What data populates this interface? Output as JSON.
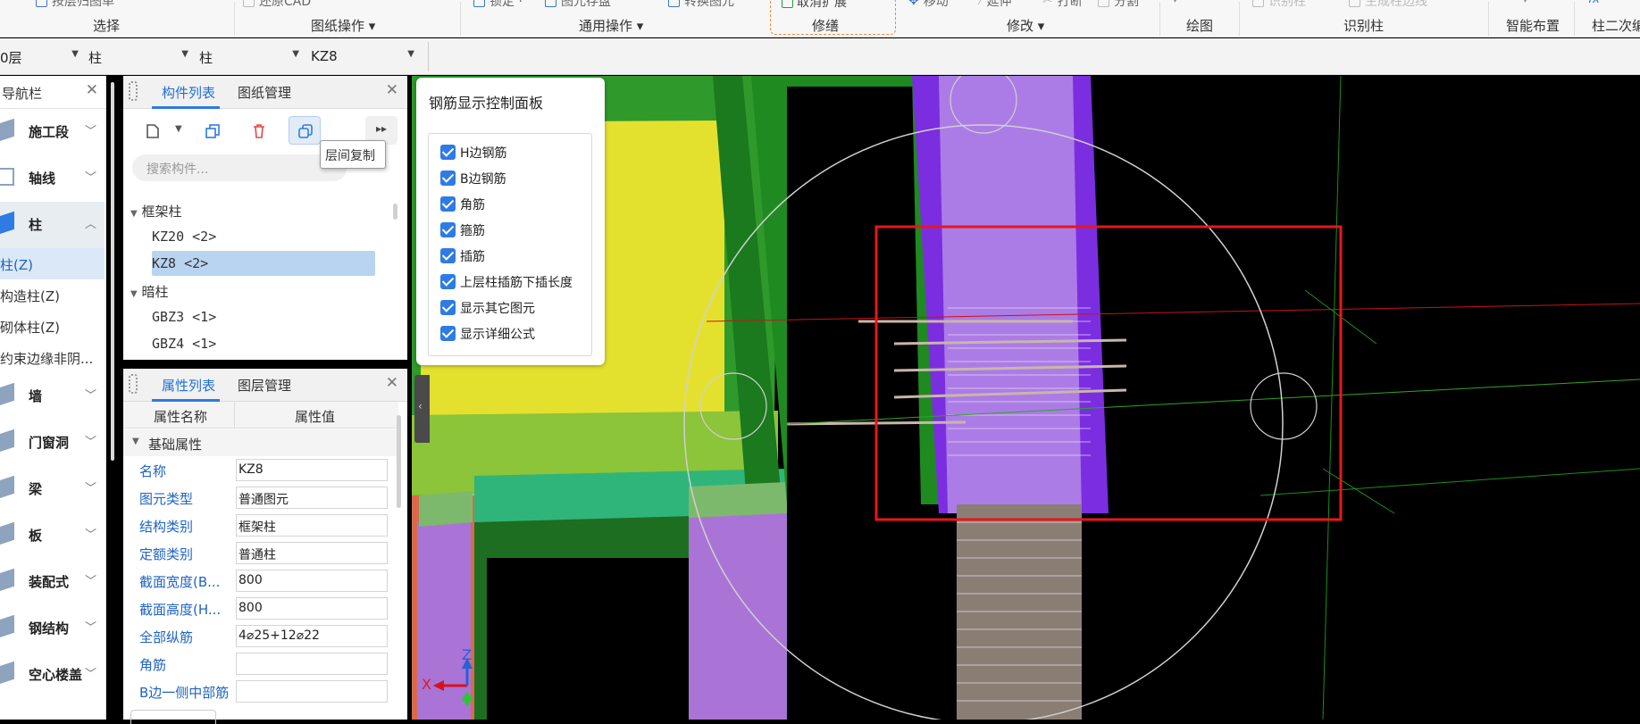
{
  "ribbon": {
    "groups": [
      {
        "cut": "按层归图单",
        "label": "选择"
      },
      {
        "cut": "还原CAD",
        "label": "图纸操作 ▾"
      },
      {
        "cut": "锁定 ·",
        "label": "通用操作 ▾"
      },
      {
        "cut": "图元存盘",
        "label": ""
      },
      {
        "cut": "转换图元",
        "label": ""
      },
      {
        "cut": "取消扩展",
        "label": "修缮"
      },
      {
        "cut": "移动",
        "label": "修改 ▾"
      },
      {
        "cut": "延伸",
        "label": ""
      },
      {
        "cut": "打断",
        "label": ""
      },
      {
        "cut": "分割",
        "label": ""
      },
      {
        "cut": "",
        "label": "绘图"
      },
      {
        "cut": "识别柱",
        "label": "识别柱"
      },
      {
        "cut": "生成柱边线",
        "label": ""
      },
      {
        "cut": "",
        "label": "智能布置"
      },
      {
        "cut": "fx",
        "label": "柱二次编"
      }
    ]
  },
  "filters": {
    "floor": "0层",
    "type1": "柱",
    "type2": "柱",
    "member": "KZ8"
  },
  "nav": {
    "title": "导航栏",
    "items": [
      {
        "label": "施工段"
      },
      {
        "label": "轴线"
      },
      {
        "label": "柱"
      },
      {
        "label": "墙"
      },
      {
        "label": "门窗洞"
      },
      {
        "label": "梁"
      },
      {
        "label": "板"
      },
      {
        "label": "装配式"
      },
      {
        "label": "钢结构"
      },
      {
        "label": "空心楼盖"
      }
    ],
    "sub_items": [
      "柱(Z)",
      "构造柱(Z)",
      "砌体柱(Z)",
      "约束边缘非阴..."
    ]
  },
  "component_panel": {
    "tabs": [
      "构件列表",
      "图纸管理"
    ],
    "search_placeholder": "搜索构件...",
    "tooltip": "层间复制",
    "categories": [
      {
        "name": "框架柱",
        "items": [
          "KZ20 <2>",
          "KZ8 <2>"
        ]
      },
      {
        "name": "暗柱",
        "items": [
          "GBZ3 <1>",
          "GBZ4 <1>"
        ]
      }
    ]
  },
  "property_panel": {
    "tabs": [
      "属性列表",
      "图层管理"
    ],
    "columns": [
      "属性名称",
      "属性值"
    ],
    "group": "基础属性",
    "rows": [
      {
        "name": "名称",
        "value": "KZ8"
      },
      {
        "name": "图元类型",
        "value": "普通图元"
      },
      {
        "name": "结构类别",
        "value": "框架柱"
      },
      {
        "name": "定额类别",
        "value": "普通柱"
      },
      {
        "name": "截面宽度(B...",
        "value": "800"
      },
      {
        "name": "截面高度(H...",
        "value": "800"
      },
      {
        "name": "全部纵筋",
        "value": "4⌀25+12⌀22"
      },
      {
        "name": "角筋",
        "value": ""
      },
      {
        "name": "B边一侧中部筋",
        "value": ""
      }
    ]
  },
  "rebar_panel": {
    "title": "钢筋显示控制面板",
    "options": [
      {
        "label": "H边钢筋",
        "checked": true
      },
      {
        "label": "B边钢筋",
        "checked": true
      },
      {
        "label": "角筋",
        "checked": true
      },
      {
        "label": "箍筋",
        "checked": true
      },
      {
        "label": "插筋",
        "checked": true
      },
      {
        "label": "上层柱插筋下插长度",
        "checked": true
      },
      {
        "label": "显示其它图元",
        "checked": true
      },
      {
        "label": "显示详细公式",
        "checked": true
      }
    ]
  },
  "axis": {
    "x": "X",
    "z": "Z"
  },
  "colors": {
    "accent": "#2e7be6",
    "highlight": "#e8161c",
    "column": "#9b59d6",
    "beam_green": "#2f9a2b",
    "slab_yellow": "#e4e12e"
  }
}
